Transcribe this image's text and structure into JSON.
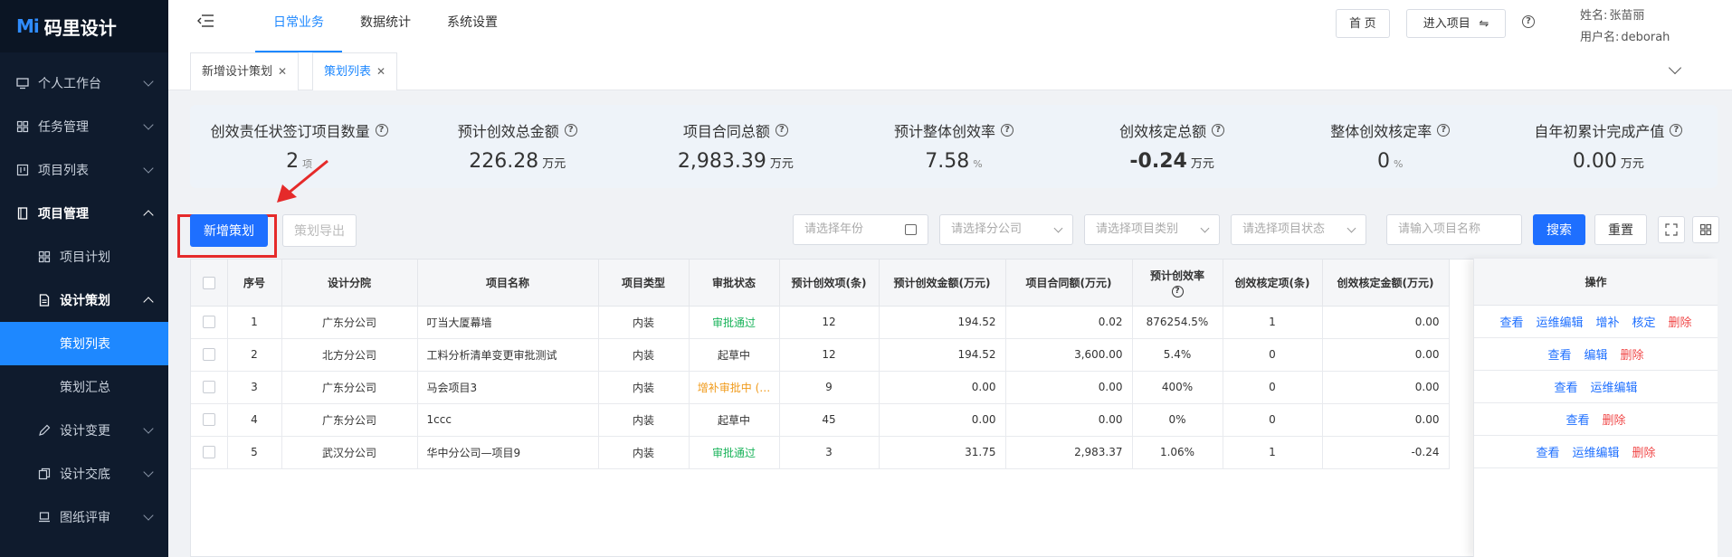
{
  "app": {
    "logo_mark": "Mi",
    "logo_text": "码里设计"
  },
  "sidebar": {
    "items": [
      {
        "label": "个人工作台",
        "icon": "monitor-icon"
      },
      {
        "label": "任务管理",
        "icon": "grid-icon"
      },
      {
        "label": "项目列表",
        "icon": "board-icon"
      },
      {
        "label": "项目管理",
        "icon": "file-icon",
        "open": true
      },
      {
        "label": "项目计划",
        "icon": "grid-icon"
      },
      {
        "label": "设计策划",
        "icon": "doc-icon",
        "open": true
      },
      {
        "label": "策划列表",
        "active": true
      },
      {
        "label": "策划汇总"
      },
      {
        "label": "设计变更",
        "icon": "pen-icon"
      },
      {
        "label": "设计交底",
        "icon": "copy-icon"
      },
      {
        "label": "图纸评审",
        "icon": "laptop-icon"
      }
    ]
  },
  "topnav": {
    "items": [
      "日常业务",
      "数据统计",
      "系统设置"
    ],
    "active_index": 0
  },
  "header": {
    "home_label": "首 页",
    "enter_project_label": "进入项目",
    "name_label": "姓名:",
    "name_value": "张苗丽",
    "username_label": "用户名:",
    "username_value": "deborah"
  },
  "tabs": [
    {
      "label": "新增设计策划",
      "active": false
    },
    {
      "label": "策划列表",
      "active": true
    }
  ],
  "stats": [
    {
      "label": "创效责任状签订项目数量",
      "value": "2",
      "unit": "项"
    },
    {
      "label": "预计创效总金额",
      "value": "226.28",
      "unit": "万元"
    },
    {
      "label": "项目合同总额",
      "value": "2,983.39",
      "unit": "万元"
    },
    {
      "label": "预计整体创效率",
      "value": "7.58",
      "unit": "%"
    },
    {
      "label": "创效核定总额",
      "value": "-0.24",
      "unit": "万元"
    },
    {
      "label": "整体创效核定率",
      "value": "0",
      "unit": "%"
    },
    {
      "label": "自年初累计完成产值",
      "value": "0.00",
      "unit": "万元"
    }
  ],
  "toolbar": {
    "add_label": "新增策划",
    "export_label": "策划导出",
    "year_placeholder": "请选择年份",
    "branch_placeholder": "请选择分公司",
    "category_placeholder": "请选择项目类别",
    "status_placeholder": "请选择项目状态",
    "name_placeholder": "请输入项目名称",
    "search_label": "搜索",
    "reset_label": "重置"
  },
  "table": {
    "headers": [
      "序号",
      "设计分院",
      "项目名称",
      "项目类型",
      "审批状态",
      "预计创效项(条)",
      "预计创效金额(万元)",
      "项目合同额(万元)",
      "预计创效率",
      "创效核定项(条)",
      "创效核定金额(万元)"
    ],
    "ops_header": "操作",
    "rows": [
      {
        "no": "1",
        "branch": "广东分公司",
        "name": "叮当大厦幕墙",
        "type": "内装",
        "status": "审批通过",
        "status_color": "green",
        "items": "12",
        "amount": "194.52",
        "contract": "0.02",
        "rate": "876254.5%",
        "verified_items": "1",
        "verified_amount": "0.00",
        "ops": [
          "查看",
          "运维编辑",
          "增补",
          "核定",
          "删除"
        ]
      },
      {
        "no": "2",
        "branch": "北方分公司",
        "name": "工料分析清单变更审批测试",
        "type": "内装",
        "status": "起草中",
        "status_color": "normal",
        "items": "12",
        "amount": "194.52",
        "contract": "3,600.00",
        "rate": "5.4%",
        "verified_items": "0",
        "verified_amount": "0.00",
        "ops": [
          "查看",
          "编辑",
          "删除"
        ]
      },
      {
        "no": "3",
        "branch": "广东分公司",
        "name": "马会项目3",
        "type": "内装",
        "status": "增补审批中 (…",
        "status_color": "orange",
        "items": "9",
        "amount": "0.00",
        "contract": "0.00",
        "rate": "400%",
        "verified_items": "0",
        "verified_amount": "0.00",
        "ops": [
          "查看",
          "运维编辑"
        ]
      },
      {
        "no": "4",
        "branch": "广东分公司",
        "name": "1ccc",
        "type": "内装",
        "status": "起草中",
        "status_color": "normal",
        "items": "45",
        "amount": "0.00",
        "contract": "0.00",
        "rate": "0%",
        "verified_items": "0",
        "verified_amount": "0.00",
        "ops": [
          "查看",
          "删除"
        ]
      },
      {
        "no": "5",
        "branch": "武汉分公司",
        "name": "华中分公司—项目9",
        "type": "内装",
        "status": "审批通过",
        "status_color": "green",
        "items": "3",
        "amount": "31.75",
        "contract": "2,983.37",
        "rate": "1.06%",
        "verified_items": "1",
        "verified_amount": "-0.24",
        "ops": [
          "查看",
          "运维编辑",
          "删除"
        ]
      }
    ]
  },
  "colors": {
    "primary": "#1e6fff",
    "sidebar_bg": "#0f1b2d",
    "active_menu": "#1e88ff",
    "approved": "#19b35a",
    "pending": "#f09a1a",
    "delete": "#f04848",
    "annotation": "#e52a2a"
  }
}
